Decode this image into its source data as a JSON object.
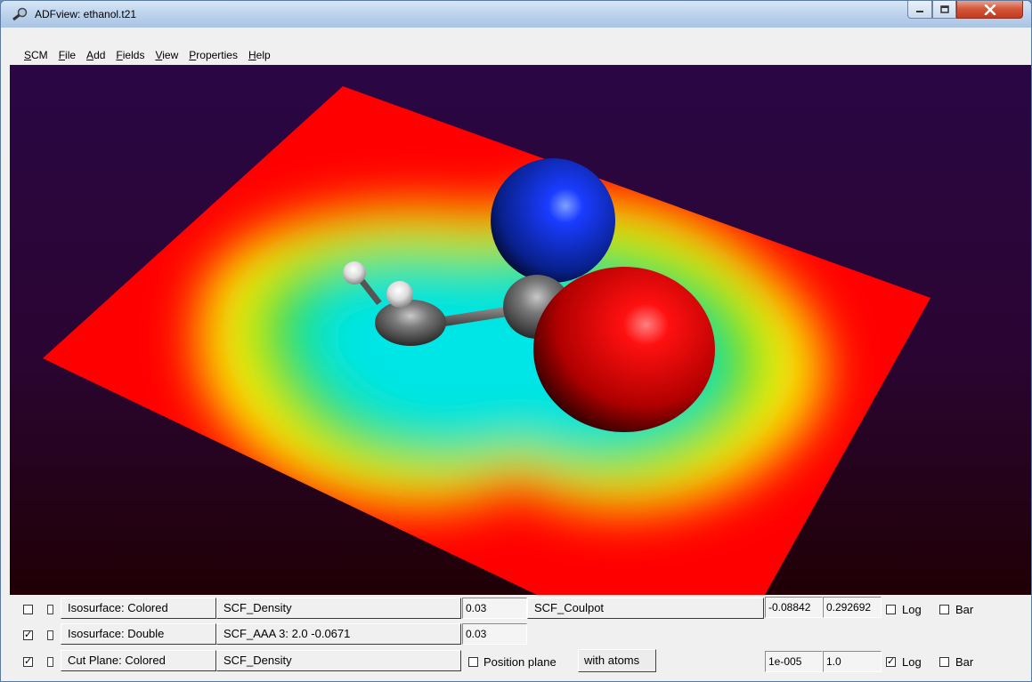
{
  "window": {
    "title": "ADFview: ethanol.t21",
    "icon": "magnifier-icon"
  },
  "menu": [
    {
      "label": "SCM",
      "key": "S",
      "rest": "CM"
    },
    {
      "label": "File",
      "key": "F",
      "rest": "ile"
    },
    {
      "label": "Add",
      "key": "A",
      "rest": "dd"
    },
    {
      "label": "Fields",
      "key": "F",
      "rest": "ields"
    },
    {
      "label": "View",
      "key": "V",
      "rest": "iew"
    },
    {
      "label": "Properties",
      "key": "P",
      "rest": "roperties"
    },
    {
      "label": "Help",
      "key": "H",
      "rest": "elp"
    }
  ],
  "colors": {
    "oxygen_atom": "#e80000",
    "nitrogen_atom": "#1030d0",
    "carbon_atom": "#6a6a6a",
    "hydrogen_atom": "#f0f0f0",
    "plane_low": "#00ffff",
    "plane_high": "#ff0000",
    "background_top": "#2a0644",
    "background_bottom": "#200005"
  },
  "rows": [
    {
      "visible": true,
      "visible_checked": false,
      "secondary_checked": false,
      "type": "Isosurface: Colored",
      "field": "SCF_Density",
      "value": "0.03",
      "color_field": "SCF_Coulpot",
      "min": "-0.08842",
      "max": "0.292692",
      "log_label": "Log",
      "log_checked": false,
      "bar_label": "Bar",
      "bar_checked": false
    },
    {
      "visible": true,
      "visible_checked": true,
      "secondary_checked": false,
      "type": "Isosurface: Double",
      "field": "SCF_AAA  3:  2.0  -0.0671",
      "value": "0.03"
    },
    {
      "visible": true,
      "visible_checked": true,
      "secondary_checked": false,
      "type": "Cut Plane: Colored",
      "field": "SCF_Density",
      "position_label": "Position plane",
      "position_checked": false,
      "with_atoms_label": "with atoms",
      "min": "1e-005",
      "max": "1.0",
      "log_label": "Log",
      "log_checked": true,
      "bar_label": "Bar",
      "bar_checked": false
    }
  ]
}
